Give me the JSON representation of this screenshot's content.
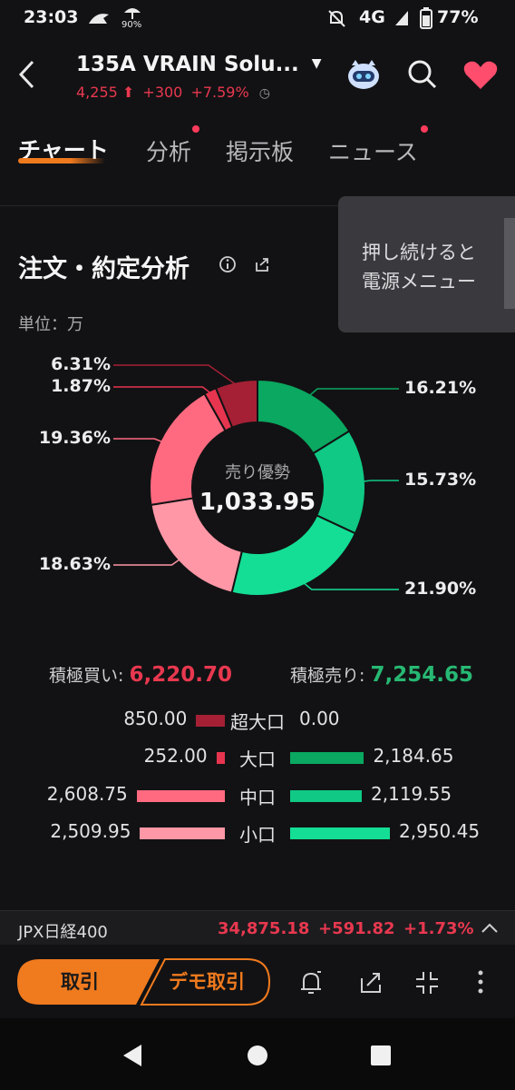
{
  "status_bar": {
    "time": "23:03",
    "signal_percent": "90%",
    "network": "4G",
    "battery": "77%"
  },
  "header": {
    "title": "135A  VRAIN Solu...",
    "price": "4,255",
    "change": "+300",
    "change_pct": "+7.59%"
  },
  "tabs": [
    {
      "label": "チャート",
      "active": true,
      "dot": false
    },
    {
      "label": "分析",
      "active": false,
      "dot": true
    },
    {
      "label": "掲示板",
      "active": false,
      "dot": false
    },
    {
      "label": "ニュース",
      "active": false,
      "dot": true
    }
  ],
  "section": {
    "title": "注文・約定分析",
    "unit_label": "単位：万"
  },
  "tooltip": {
    "line1": "押し続けると",
    "line2": "電源メニュー"
  },
  "chart_data": {
    "type": "pie",
    "center_label": "売り優勢",
    "center_value": "1,033.95",
    "slices": [
      {
        "label": "16.21%",
        "value": 16.21,
        "color": "#0aa860"
      },
      {
        "label": "15.73%",
        "value": 15.73,
        "color": "#0fc984"
      },
      {
        "label": "21.90%",
        "value": 21.9,
        "color": "#14de95"
      },
      {
        "label": "18.63%",
        "value": 18.63,
        "color": "#ff97a6"
      },
      {
        "label": "19.36%",
        "value": 19.36,
        "color": "#ff6a80"
      },
      {
        "label": "1.87%",
        "value": 1.87,
        "color": "#e8354f"
      },
      {
        "label": "6.31%",
        "value": 6.31,
        "color": "#a52035"
      }
    ]
  },
  "summary": {
    "buy_label": "積極買い:",
    "buy_value": "6,220.70",
    "sell_label": "積極売り:",
    "sell_value": "7,254.65"
  },
  "breakdown": [
    {
      "label": "超大口",
      "buy": "850.00",
      "buy_amount": 850.0,
      "sell": "0.00",
      "sell_amount": 0.0,
      "buy_color": "#a52035",
      "sell_color": "#0aa860"
    },
    {
      "label": "大口",
      "buy": "252.00",
      "buy_amount": 252.0,
      "sell": "2,184.65",
      "sell_amount": 2184.65,
      "buy_color": "#e8354f",
      "sell_color": "#0aa860"
    },
    {
      "label": "中口",
      "buy": "2,608.75",
      "buy_amount": 2608.75,
      "sell": "2,119.55",
      "sell_amount": 2119.55,
      "buy_color": "#ff6a80",
      "sell_color": "#0fc984"
    },
    {
      "label": "小口",
      "buy": "2,509.95",
      "buy_amount": 2509.95,
      "sell": "2,950.45",
      "sell_amount": 2950.45,
      "buy_color": "#ff97a6",
      "sell_color": "#14de95"
    }
  ],
  "ticker": {
    "name": "JPX日経400",
    "value": "34,875.18",
    "change": "+591.82",
    "change_pct": "+1.73%"
  },
  "actions": {
    "trade": "取引",
    "demo_trade": "デモ取引"
  },
  "colors": {
    "up": "#e8384f",
    "down_green": "#27b873",
    "accent": "#f07a1e"
  }
}
